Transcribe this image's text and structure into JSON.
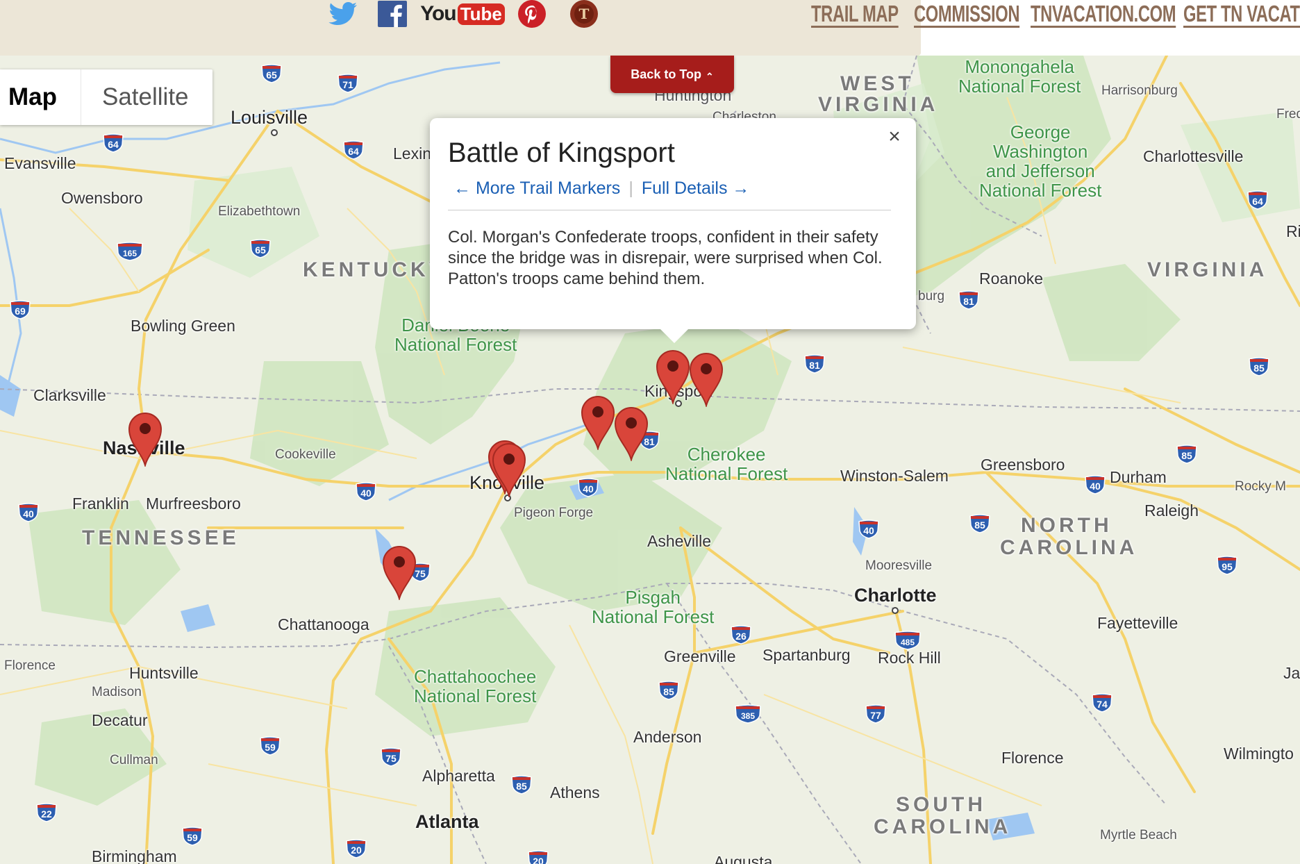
{
  "header": {
    "social": [
      {
        "name": "twitter-icon"
      },
      {
        "name": "facebook-icon"
      },
      {
        "name": "youtube-icon",
        "label_a": "You",
        "label_b": "Tube"
      },
      {
        "name": "pinterest-icon"
      },
      {
        "name": "tennessee-logo-icon"
      }
    ],
    "nav": {
      "trail_map": "TRAIL MAP",
      "commission": "COMMISSION",
      "tnvacation": "TNVACATION.COM",
      "get_tn": "GET TN VACATIO"
    }
  },
  "back_to_top": {
    "label": "Back to Top",
    "arrow": "⌃"
  },
  "map_type": {
    "map": "Map",
    "satellite": "Satellite"
  },
  "info_window": {
    "title": "Battle of Kingsport",
    "more_markers": "← More Trail Markers",
    "separator": "|",
    "full_details": "Full Details →",
    "close": "×",
    "description": "Col. Morgan's Confederate troops, confident in their safety since the bridge was in disrepair, were surprised when Col. Patton's troops came behind them."
  },
  "map_labels": {
    "states": {
      "kentucky": "KENTUCKY",
      "tennessee": "TENNESSEE",
      "virginia": "VIRGINIA",
      "west_virginia_1": "WEST",
      "west_virginia_2": "VIRGINIA",
      "north_carolina_1": "NORTH",
      "north_carolina_2": "CAROLINA",
      "south_carolina_1": "SOUTH",
      "south_carolina_2": "CAROLINA"
    },
    "forests": {
      "monongahela_1": "Monongahela",
      "monongahela_2": "National Forest",
      "gw_1": "George",
      "gw_2": "Washington",
      "gw_3": "and Jefferson",
      "gw_4": "National Forest",
      "boone_1": "Daniel Boone",
      "boone_2": "National Forest",
      "cherokee_1": "Cherokee",
      "cherokee_2": "National Forest",
      "pisgah_1": "Pisgah",
      "pisgah_2": "National Forest",
      "chatt_1": "Chattahoochee",
      "chatt_2": "National Forest"
    },
    "cities": {
      "louisville": "Louisville",
      "evansville": "Evansville",
      "owensboro": "Owensboro",
      "elizabethtown": "Elizabethtown",
      "lexington": "Lexin",
      "huntington": "Huntington",
      "charleston": "Charleston",
      "harrisonburg": "Harrisonburg",
      "charlottesville": "Charlottesville",
      "roanoke": "Roanoke",
      "blacksburg": "burg",
      "bowling_green": "Bowling Green",
      "clarksville": "Clarksville",
      "nashville": "Nashville",
      "cookeville": "Cookeville",
      "franklin": "Franklin",
      "murfreesboro": "Murfreesboro",
      "knoxville": "Knoxville",
      "pigeon_forge": "Pigeon Forge",
      "kingsport": "Kingsport",
      "asheville": "Asheville",
      "winston_salem": "Winston-Salem",
      "greensboro": "Greensboro",
      "durham": "Durham",
      "raleigh": "Raleigh",
      "rocky_mount": "Rocky M",
      "mooresville": "Mooresville",
      "charlotte": "Charlotte",
      "fayetteville": "Fayetteville",
      "chattanooga": "Chattanooga",
      "florence_al": "Florence",
      "huntsville": "Huntsville",
      "madison": "Madison",
      "decatur": "Decatur",
      "cullman": "Cullman",
      "greenville": "Greenville",
      "spartanburg": "Spartanburg",
      "rock_hill": "Rock Hill",
      "anderson": "Anderson",
      "alpharetta": "Alpharetta",
      "athens": "Athens",
      "atlanta": "Atlanta",
      "florence_sc": "Florence",
      "wilmington": "Wilmingto",
      "myrtle_beach": "Myrtle Beach",
      "birmingham": "Birmingham",
      "augusta": "Augusta",
      "fred": "Fred",
      "ri": "Ri",
      "ja": "Ja"
    },
    "highways": [
      "65",
      "71",
      "64",
      "64",
      "165",
      "65",
      "69",
      "81",
      "81",
      "81",
      "85",
      "85",
      "40",
      "40",
      "40",
      "40",
      "40",
      "85",
      "95",
      "485",
      "26",
      "85",
      "385",
      "77",
      "74",
      "59",
      "75",
      "85",
      "22",
      "59",
      "20",
      "20",
      "75",
      "64"
    ]
  },
  "colors": {
    "nav_text": "#8c6d58",
    "header_beige": "#ece6d7",
    "back_to_top": "#a61d1b",
    "marker": "#d9453a",
    "forest_text": "#3e9448",
    "link": "#1a5fb4",
    "interstate": "#2d5fb0"
  }
}
